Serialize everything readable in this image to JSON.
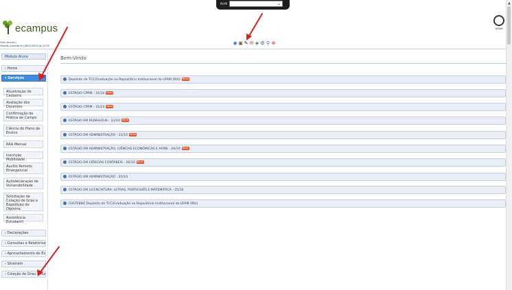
{
  "topbar": {
    "label": "Perfil",
    "select_value": "",
    "chevron": "⌄"
  },
  "header": {
    "logo_text": "ecampus",
    "session_lines": [
      "Sem vinculo |",
      "Sessão iniciada em 28/11/2023 às 11:29"
    ],
    "ufam_text": "UFAM",
    "toolbar_icons": [
      "◉",
      "▣",
      "✎",
      "✉",
      "◈",
      "⚙",
      "⚲",
      "⊗"
    ]
  },
  "sidebar": {
    "module": "Módulo Aluno",
    "items": [
      {
        "label": "› Home"
      },
      {
        "label": "▾ Serviços"
      }
    ],
    "sub_items": [
      "Atualização de Cadastro",
      "Avaliação dos Docentes",
      "Confirmação de Prática de Campo",
      "Ciência do Plano de Ensino",
      "RAA Mensal",
      "Inscrição Mobilidade",
      "Auxílio Remoto Emergencial",
      "Autodeclaração de Vulnerabilidade",
      "Solicitação de Colação de Grau e Expedição de Diploma",
      "Assistência Estudantil"
    ],
    "bottom_items": [
      "› Declarações",
      "› Consultas e Relatórios",
      "› Aproveitamento de Estudos",
      "› Sinetram",
      "› Colação de Grau - Aluno"
    ]
  },
  "main": {
    "title": "Bem-Vindo",
    "rows": [
      {
        "text": "Depósito de TCC/Graduação no Repositório Institucional da UFAM (RIU)",
        "badge": "Novo"
      },
      {
        "text": "ESTÁGIO CPRM - 31/10",
        "badge": "Novo"
      },
      {
        "text": "ESTÁGIO CPRM - 31/10",
        "badge": "Novo"
      },
      {
        "text": "ESTÁGIO EM PEDAGOGIA - 31/10",
        "badge": "Novo"
      },
      {
        "text": "ESTÁGIO EM ADMINISTRAÇÃO - 31/10",
        "badge": "Novo"
      },
      {
        "text": "ESTÁGIO EM ADMINISTRAÇÃO, CIÊNCIAS ECONÔMICAS E AFINS - 26/10",
        "badge": "Novo"
      },
      {
        "text": "ESTÁGIO EM CIÊNCIAS CONTÁBEIS - 26/10",
        "badge": "Novo"
      },
      {
        "text": "ESTÁGIO EM ADMINISTRAÇÃO - 25/10",
        "badge": ""
      },
      {
        "text": "ESTÁGIO EM LICENCIATURA: LETRAS, PORTUGUÊS E MATEMÁTICA - 25/10",
        "badge": ""
      },
      {
        "text": "[SISTEBIB] Depósito de TCC/Graduação no Repositório Institucional da UFAM (RIU)",
        "badge": ""
      }
    ]
  },
  "colors": {
    "accent": "#3f8de0",
    "badge": "#e8562a",
    "annotation": "#d81e1e"
  }
}
